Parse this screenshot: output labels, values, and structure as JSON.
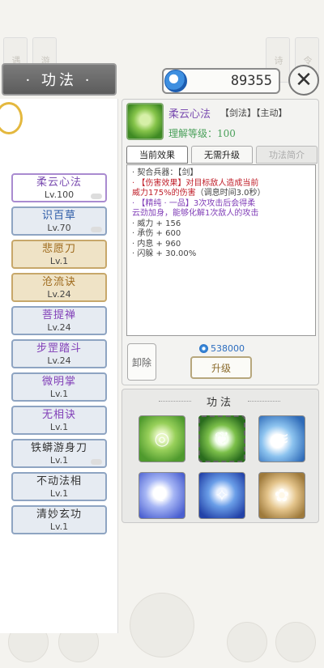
{
  "header": {
    "title": "· 功法 ·",
    "currency_value": "89355"
  },
  "skill_list": [
    {
      "name": "柔云心法",
      "level": "Lv.100"
    },
    {
      "name": "识百草",
      "level": "Lv.70"
    },
    {
      "name": "悲愿刀",
      "level": "Lv.1"
    },
    {
      "name": "沧流诀",
      "level": "Lv.24"
    },
    {
      "name": "菩提禅",
      "level": "Lv.24"
    },
    {
      "name": "步罡踏斗",
      "level": "Lv.24"
    },
    {
      "name": "微明掌",
      "level": "Lv.1"
    },
    {
      "name": "无相诀",
      "level": "Lv.1"
    },
    {
      "name": "铁蟒游身刀",
      "level": "Lv.1"
    },
    {
      "name": "不动法相",
      "level": "Lv.1"
    },
    {
      "name": "清妙玄功",
      "level": "Lv.1"
    }
  ],
  "detail": {
    "name": "柔云心法",
    "tags": "【剑法】【主动】",
    "comprehension": "理解等级：100",
    "tabs": [
      "当前效果",
      "无需升级",
      "功法简介"
    ],
    "effect_lines": {
      "weapon": "· 契合兵器：【剑】",
      "damage_tag": "· 【伤害效果】",
      "damage_text": "对目标敌人造成当前",
      "damage_text2": "威力175%的伤害",
      "damage_note": "（调息时间3.0秒）",
      "special_tag": "· 【精纯 · 一品】",
      "special_text": "3次攻击后会得柔",
      "special_text2": "云劲加身，能够化解1次敌人的攻击",
      "power": "· 威力 + 156",
      "block": "· 承伤 + 600",
      "inner": "· 内息 + 960",
      "dodge": "· 闪躲 + 30.00%"
    },
    "unload_label": "卸除",
    "upgrade_cost": "538000",
    "upgrade_label": "升级"
  },
  "grid": {
    "title": "功法"
  }
}
